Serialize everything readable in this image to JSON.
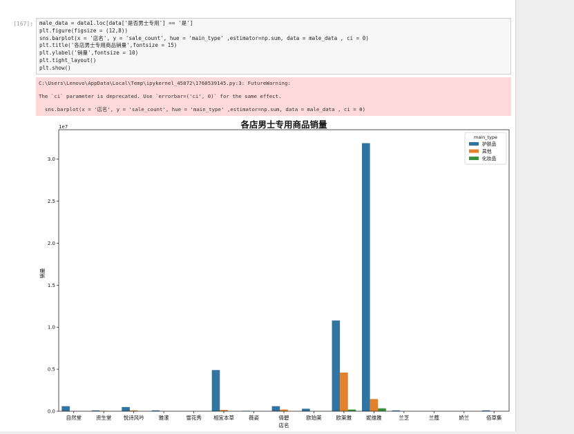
{
  "notebook": {
    "prompt": "[167]:",
    "code_lines": [
      "male_data = data1.loc[data['是否男士专用'] == '是']",
      "plt.figure(figsize = (12,8))",
      "sns.barplot(x = '店名', y = 'sale_count', hue = 'main_type' ,estimator=np.sum, data = male_data , ci = 0)",
      "plt.title('各店男士专用商品销量',fontsize = 15)",
      "plt.ylabel('销量',fontsize = 10)",
      "plt.tight_layout()",
      "plt.show()"
    ],
    "stderr_lines": [
      "C:\\Users\\Lenovo\\AppData\\Local\\Temp\\ipykernel_45872\\1760539145.py:3: FutureWarning:",
      "The `ci` parameter is deprecated. Use `errorbar=('ci', 0)` for the same effect.",
      "  sns.barplot(x = '店名', y = 'sale_count', hue = 'main_type' ,estimator=np.sum, data = male_data , ci = 0)"
    ]
  },
  "chart_data": {
    "type": "bar",
    "title": "各店男士专用商品销量",
    "xlabel": "店名",
    "ylabel": "销量",
    "y_scale_label": "1e7",
    "ylim": [
      0,
      3.35
    ],
    "yticks": [
      0.0,
      0.5,
      1.0,
      1.5,
      2.0,
      2.5,
      3.0
    ],
    "ytick_labels": [
      "0.0",
      "0.5",
      "1.0",
      "1.5",
      "2.0",
      "2.5",
      "3.0"
    ],
    "legend_title": "main_type",
    "legend_position": "top-right",
    "grid": false,
    "categories": [
      "自然堂",
      "资生堂",
      "悦诗风吟",
      "雅漾",
      "雪花秀",
      "相宜本草",
      "薇姿",
      "倩碧",
      "欧珀莱",
      "欧莱雅",
      "妮维雅",
      "兰芝",
      "兰蔻",
      "娇兰",
      "佰草集"
    ],
    "series": [
      {
        "name": "护肤品",
        "color": "#3274a1",
        "values": [
          0.06,
          0.01,
          0.05,
          0.01,
          0.0,
          0.49,
          0.005,
          0.06,
          0.03,
          1.08,
          3.19,
          0.01,
          0.0,
          0.0,
          0.01
        ]
      },
      {
        "name": "其他",
        "color": "#e1812c",
        "values": [
          0.0,
          0.005,
          0.01,
          0.0,
          0.0,
          0.015,
          0.0,
          0.02,
          0.0,
          0.46,
          0.145,
          0.0,
          0.0,
          0.0,
          0.0
        ]
      },
      {
        "name": "化妆品",
        "color": "#3a923a",
        "values": [
          0.0,
          0.0,
          0.0,
          0.0,
          0.0,
          0.0,
          0.0,
          0.0,
          0.0,
          0.02,
          0.035,
          0.0,
          0.0,
          0.0,
          0.0
        ]
      }
    ]
  }
}
